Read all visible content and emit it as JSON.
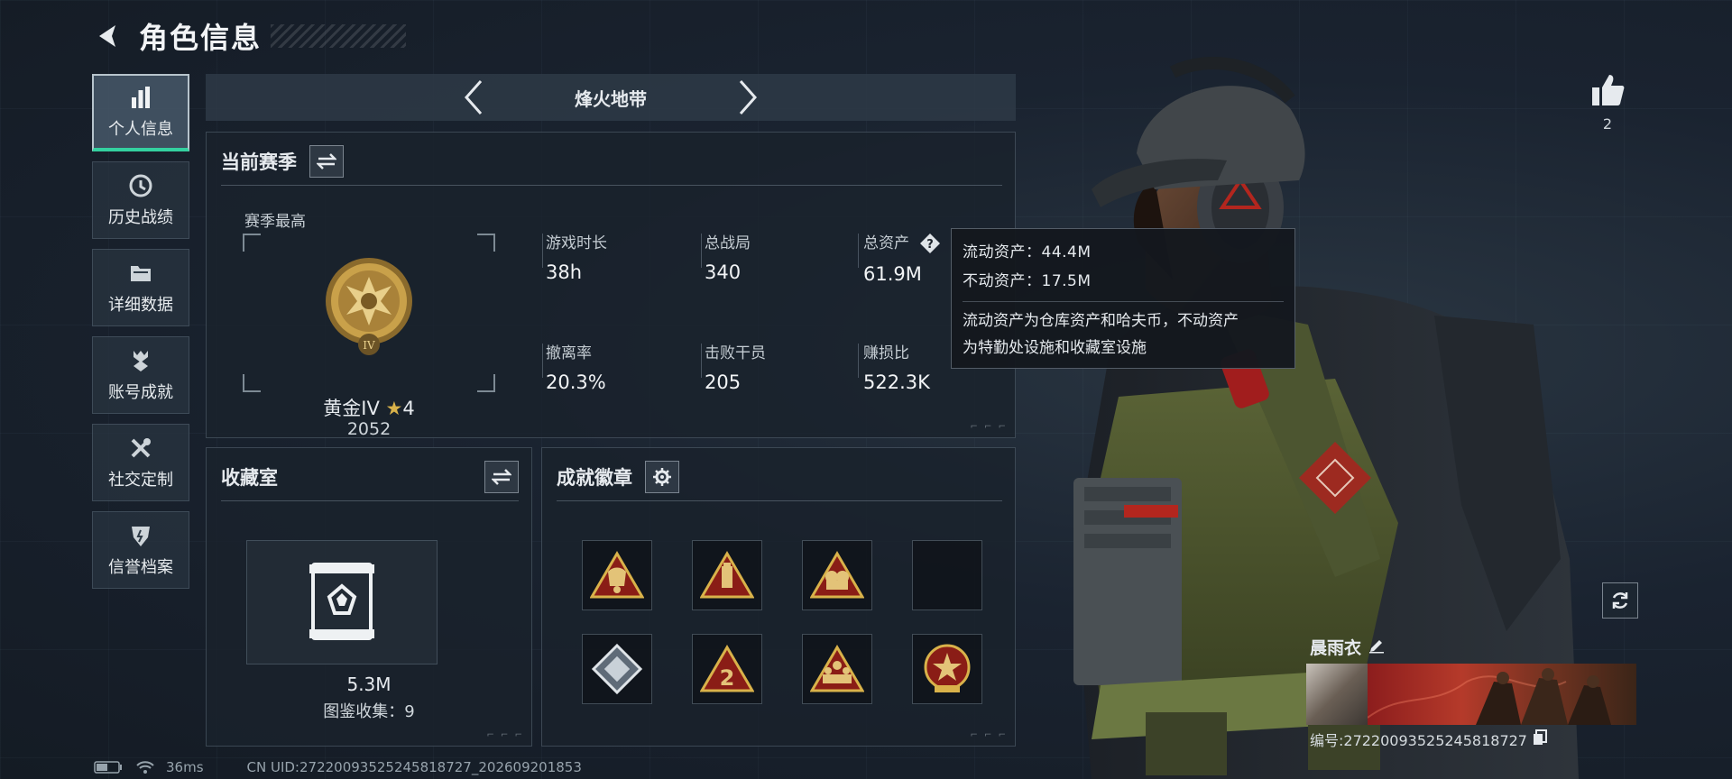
{
  "header": {
    "title": "角色信息"
  },
  "sidebar": {
    "items": [
      {
        "label": "个人信息",
        "icon": "bar-chart-icon",
        "active": true
      },
      {
        "label": "历史战绩",
        "icon": "history-clock-icon"
      },
      {
        "label": "详细数据",
        "icon": "folder-icon"
      },
      {
        "label": "账号成就",
        "icon": "achievement-icon"
      },
      {
        "label": "社交定制",
        "icon": "tools-icon"
      },
      {
        "label": "信誉档案",
        "icon": "shield-icon"
      }
    ]
  },
  "mode": {
    "name": "烽火地带"
  },
  "season": {
    "title": "当前赛季",
    "best_label": "赛季最高",
    "rank_name": "黄金IV",
    "rank_stars": "4",
    "rank_score": "2052",
    "rank_badge_numeral": "IV",
    "stats": [
      {
        "label": "游戏时长",
        "value": "38h"
      },
      {
        "label": "总战局",
        "value": "340"
      },
      {
        "label": "总资产",
        "value": "61.9M"
      },
      {
        "label": "撤离率",
        "value": "20.3%"
      },
      {
        "label": "击败干员",
        "value": "205"
      },
      {
        "label": "赚损比",
        "value": "522.3K"
      }
    ]
  },
  "tooltip": {
    "liquid": "流动资产：44.4M",
    "fixed": "不动资产：17.5M",
    "note_line1": "流动资产为仓库资产和哈夫币，不动资产",
    "note_line2": "为特勤处设施和收藏室设施"
  },
  "collection": {
    "title": "收藏室",
    "value": "5.3M",
    "sub": "图鉴收集：9"
  },
  "badges": {
    "title": "成就徽章",
    "slots": [
      "badge-flag-icon",
      "badge-ammo-icon",
      "badge-fist-icon",
      "empty",
      "badge-box-icon",
      "badge-number-icon",
      "badge-squad-icon",
      "badge-star-medal-icon"
    ]
  },
  "likes": {
    "count": "2"
  },
  "character": {
    "name": "晨雨衣",
    "uid": "编号:27220093525245818727"
  },
  "status": {
    "ping": "36ms",
    "cn_uid": "CN UID:27220093525245818727_202609201853"
  },
  "colors": {
    "accent": "#34d1a0",
    "gold": "#c9a14a",
    "badge_red": "#b3261e"
  }
}
